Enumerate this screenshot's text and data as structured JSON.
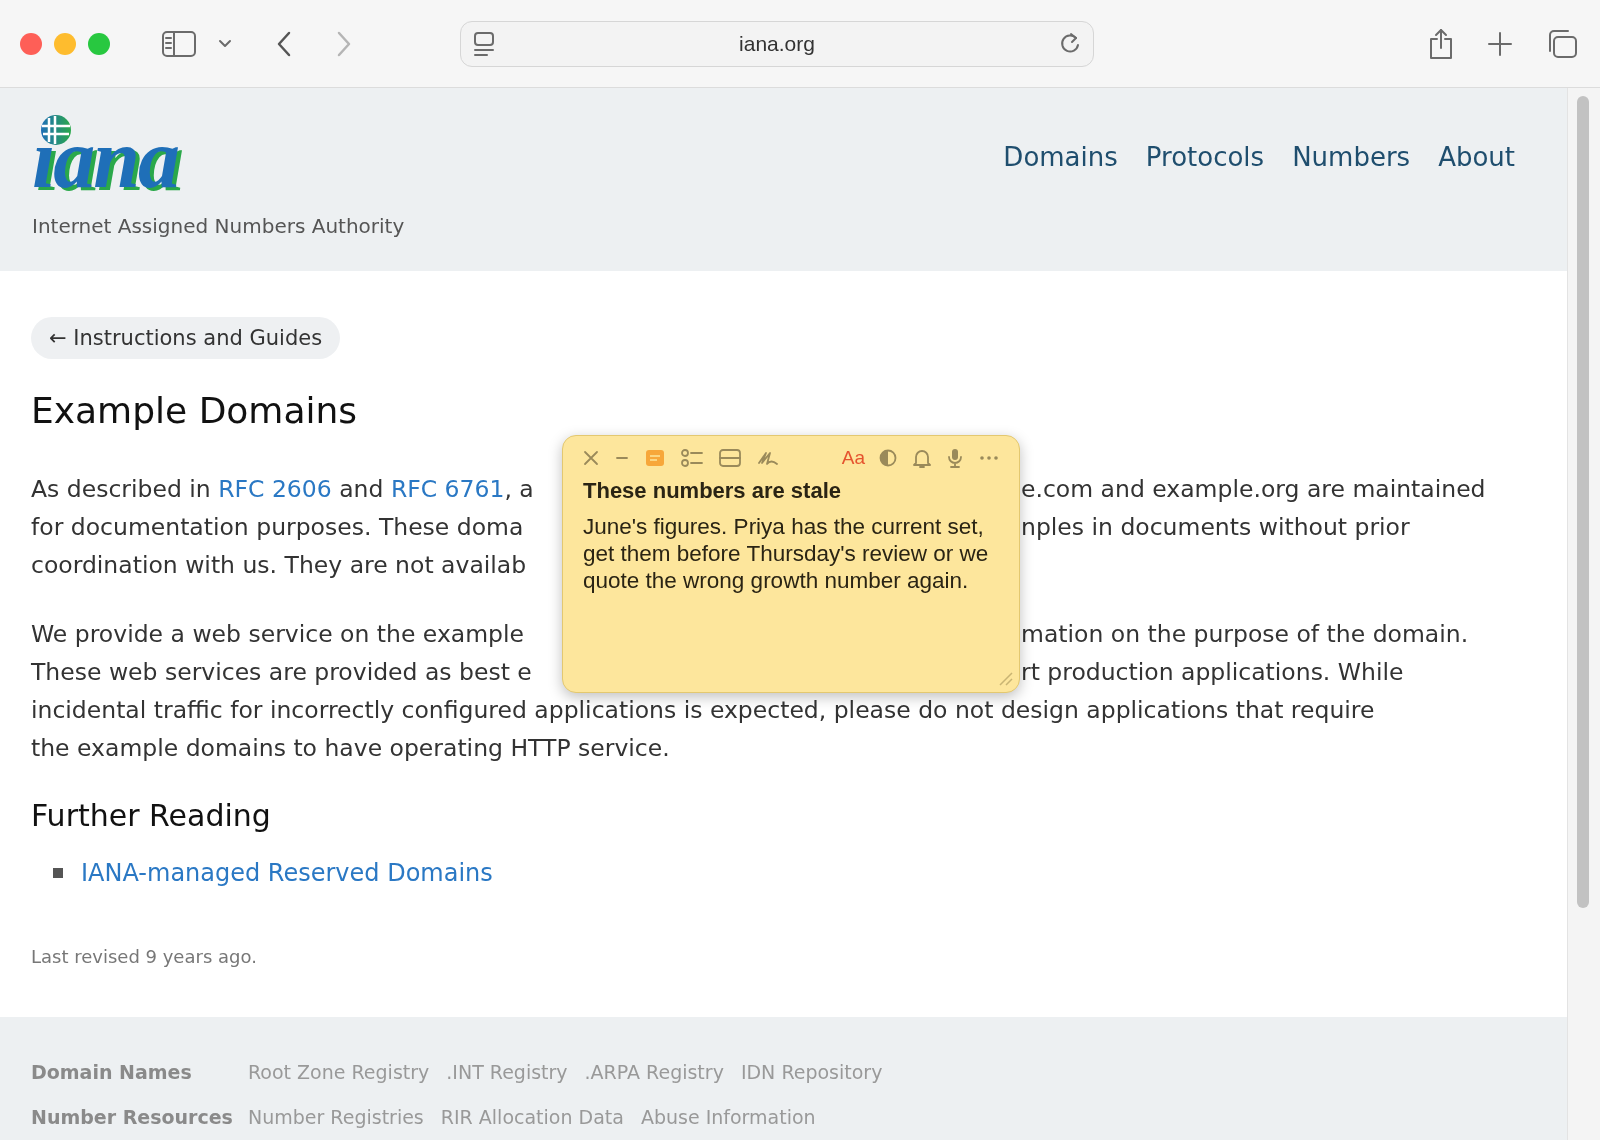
{
  "browser": {
    "address": "iana.org",
    "forward_disabled": true
  },
  "header": {
    "logo_text": "iana",
    "tagline": "Internet Assigned Numbers Authority",
    "nav": [
      "Domains",
      "Protocols",
      "Numbers",
      "About"
    ]
  },
  "main": {
    "back_link": "← Instructions and Guides",
    "title": "Example Domains",
    "paragraphs": [
      {
        "lines": [
          {
            "left": [
              {
                "kind": "text",
                "text": "As described in "
              },
              {
                "kind": "link",
                "text": "RFC 2606"
              },
              {
                "kind": "text",
                "text": " and "
              },
              {
                "kind": "link",
                "text": "RFC 6761"
              },
              {
                "kind": "text",
                "text": ", a"
              }
            ],
            "right": "e.com and example.org are maintained"
          },
          {
            "left": [
              {
                "kind": "text",
                "text": "for documentation purposes. These doma"
              }
            ],
            "right": "nples in documents without prior"
          },
          {
            "left": [
              {
                "kind": "text",
                "text": "coordination with us. They are not availab"
              }
            ]
          }
        ]
      },
      {
        "lines": [
          {
            "left": [
              {
                "kind": "text",
                "text": "We provide a web service on the example"
              }
            ],
            "right": "mation on the purpose of the domain."
          },
          {
            "left": [
              {
                "kind": "text",
                "text": "These web services are provided as best e"
              }
            ],
            "right": "rt production applications. While"
          },
          {
            "left": [
              {
                "kind": "text",
                "text": "incidental traffic for incorrectly configured applications is expected, please do not design applications that require"
              }
            ]
          },
          {
            "left": [
              {
                "kind": "text",
                "text": "the example domains to have operating HTTP service."
              }
            ]
          }
        ]
      }
    ],
    "further_heading": "Further Reading",
    "links": [
      "IANA-managed Reserved Domains"
    ],
    "revised": "Last revised 9 years ago."
  },
  "note": {
    "format_label": "Aa",
    "title": "These numbers are stale",
    "body": "June's figures. Priya has the current set, get them before Thursday's review or we quote the wrong growth number again."
  },
  "footer": {
    "rows": [
      {
        "label": "Domain Names",
        "links": [
          "Root Zone Registry",
          ".INT Registry",
          ".ARPA Registry",
          "IDN Repository"
        ]
      },
      {
        "label": "Number Resources",
        "links": [
          "Number Registries",
          "RIR Allocation Data",
          "Abuse Information"
        ]
      }
    ]
  }
}
